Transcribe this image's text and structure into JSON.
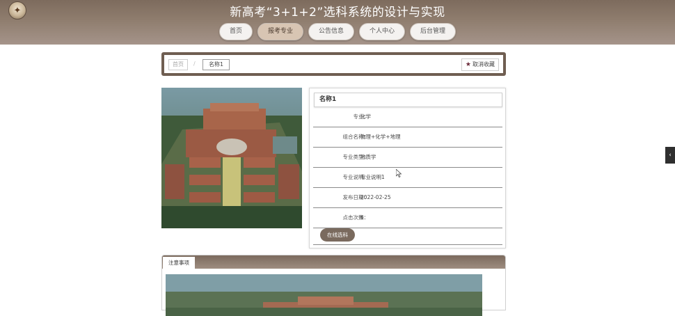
{
  "header": {
    "title": "新高考“3+1+2”选科系统的设计与实现",
    "logo_icon": "school-emblem-icon"
  },
  "nav": {
    "items": [
      "首页",
      "报考专业",
      "公告信息",
      "个人中心",
      "后台管理"
    ],
    "active": "报考专业"
  },
  "breadcrumb": {
    "home": "首页",
    "separator": "/",
    "current": "名称1",
    "favorite_label": "取消收藏"
  },
  "detail": {
    "title": "名称1",
    "rows": [
      {
        "label": "专业：",
        "value": "化学"
      },
      {
        "label": "组合名称：",
        "value": "物理+化学+地理"
      },
      {
        "label": "专业类型：",
        "value": "地质学"
      },
      {
        "label": "专业说明：",
        "value": "专业说明1"
      },
      {
        "label": "发布日期：",
        "value": "2022-02-25"
      },
      {
        "label": "点击次数：",
        "value": "6"
      }
    ],
    "choose_label": "在线选科"
  },
  "notes": {
    "tab_label": "注意事项"
  },
  "colors": {
    "header": "#8f7d6e",
    "accent": "#6f5e51",
    "button": "#7a6a5e",
    "star": "#6b2b3a"
  }
}
